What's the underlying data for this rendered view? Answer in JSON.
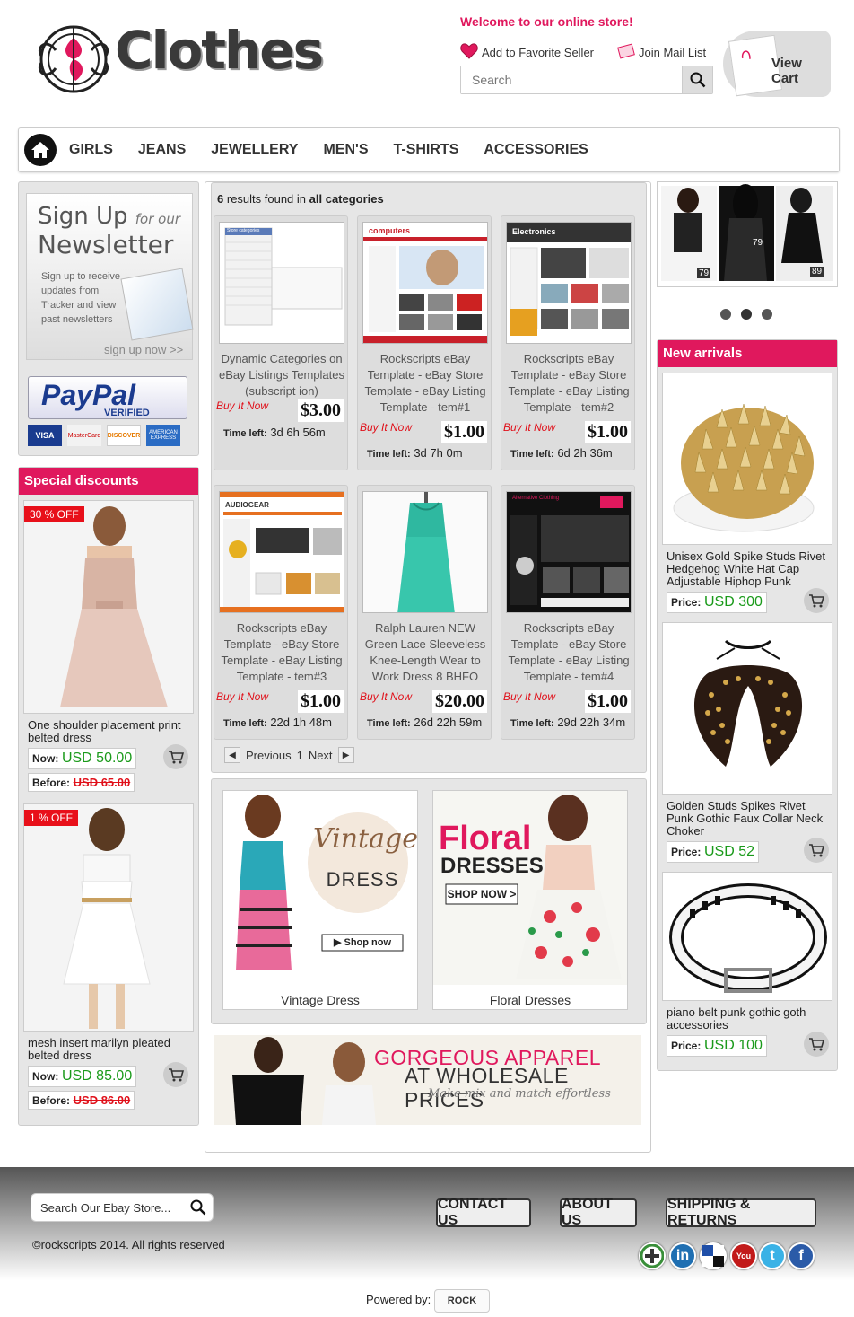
{
  "header": {
    "logo_text": "Clothes",
    "welcome": "Welcome to our online store!",
    "favorite_label": "Add to Favorite Seller",
    "mail_label": "Join Mail List",
    "search_placeholder": "Search",
    "cart_label": "View Cart"
  },
  "nav": {
    "items": [
      "GIRLS",
      "JEANS",
      "JEWELLERY",
      "MEN'S",
      "T-SHIRTS",
      "ACCESSORIES"
    ]
  },
  "newsletter": {
    "title1": "Sign Up",
    "title_for": "for our",
    "title2": "Newsletter",
    "body": "Sign up to receive updates from Tracker and view past newsletters",
    "cta": "sign up now >>",
    "paypal": "PayPal",
    "paypal_verified": "VERIFIED",
    "cards": [
      "VISA",
      "MasterCard",
      "DISCOVER",
      "AMERICAN EXPRESS"
    ]
  },
  "special": {
    "heading": "Special discounts",
    "items": [
      {
        "badge": "30 % OFF",
        "name": "One shoulder placement print belted dress",
        "now_label": "Now:",
        "now": "USD 50.00",
        "before_label": "Before:",
        "before": "USD 65.00"
      },
      {
        "badge": "1 % OFF",
        "name": "mesh insert marilyn pleated belted dress",
        "now_label": "Now:",
        "now": "USD 85.00",
        "before_label": "Before:",
        "before": "USD 86.00"
      }
    ]
  },
  "results": {
    "count": "6",
    "found_text": "results found in",
    "scope": "all categories",
    "time_left_label": "Time left:",
    "buy_it_now": "Buy It Now",
    "products": [
      {
        "title": "Dynamic Categories on eBay Listings Templates (subscript ion)",
        "price": "$3.00",
        "time": "3d 6h 56m"
      },
      {
        "title": "Rockscripts eBay Template - eBay Store Template - eBay Listing Template - tem#1",
        "price": "$1.00",
        "time": "3d 7h 0m"
      },
      {
        "title": "Rockscripts eBay Template - eBay Store Template - eBay Listing Template - tem#2",
        "price": "$1.00",
        "time": "6d 2h 36m"
      },
      {
        "title": "Rockscripts eBay Template - eBay Store Template - eBay Listing Template - tem#3",
        "price": "$1.00",
        "time": "22d 1h 48m"
      },
      {
        "title": "Ralph Lauren NEW Green Lace Sleeveless Knee-Length Wear to Work Dress 8 BHFO",
        "price": "$20.00",
        "time": "26d 22h 59m"
      },
      {
        "title": "Rockscripts eBay Template - eBay Store Template - eBay Listing Template - tem#4",
        "price": "$1.00",
        "time": "29d 22h 34m"
      }
    ],
    "image_texts": [
      "Store categories",
      "computers",
      "Electronics",
      "AUDIOGEAR",
      "Alternative Clothing"
    ],
    "pager": {
      "prev": "Previous",
      "page": "1",
      "next": "Next"
    }
  },
  "banners": [
    {
      "caption": "Vintage Dress",
      "line1": "Vintage",
      "line2": "DRESS",
      "button": "Shop now"
    },
    {
      "caption": "Floral Dresses",
      "line1": "Floral",
      "line2": "DRESSES",
      "button": "SHOP NOW >"
    }
  ],
  "wholesale": {
    "line1": "GORGEOUS APPAREL",
    "line2": "AT WHOLESALE PRICES",
    "line3": "Make mix and match effortless"
  },
  "slider": {
    "prices": [
      "79",
      "79",
      "89"
    ]
  },
  "arrivals": {
    "heading": "New arrivals",
    "price_label": "Price:",
    "items": [
      {
        "name": "Unisex Gold Spike Studs Rivet Hedgehog White Hat Cap Adjustable Hiphop Punk",
        "price": "USD 300"
      },
      {
        "name": "Golden Studs Spikes Rivet Punk Gothic Faux Collar Neck Choker",
        "price": "USD 52"
      },
      {
        "name": "piano belt punk gothic goth accessories",
        "price": "USD 100"
      }
    ]
  },
  "footer": {
    "search_placeholder": "Search Our Ebay Store...",
    "contact": "CONTACT US",
    "about": "ABOUT US",
    "shipping": "SHIPPING & RETURNS",
    "copyright": "©rockscripts 2014. All rights reserved",
    "powered": "Powered by:",
    "powered_brand": "ROCK"
  },
  "colors": {
    "accent": "#e0185d",
    "green": "#1a9a1a",
    "red": "#e0101a"
  }
}
